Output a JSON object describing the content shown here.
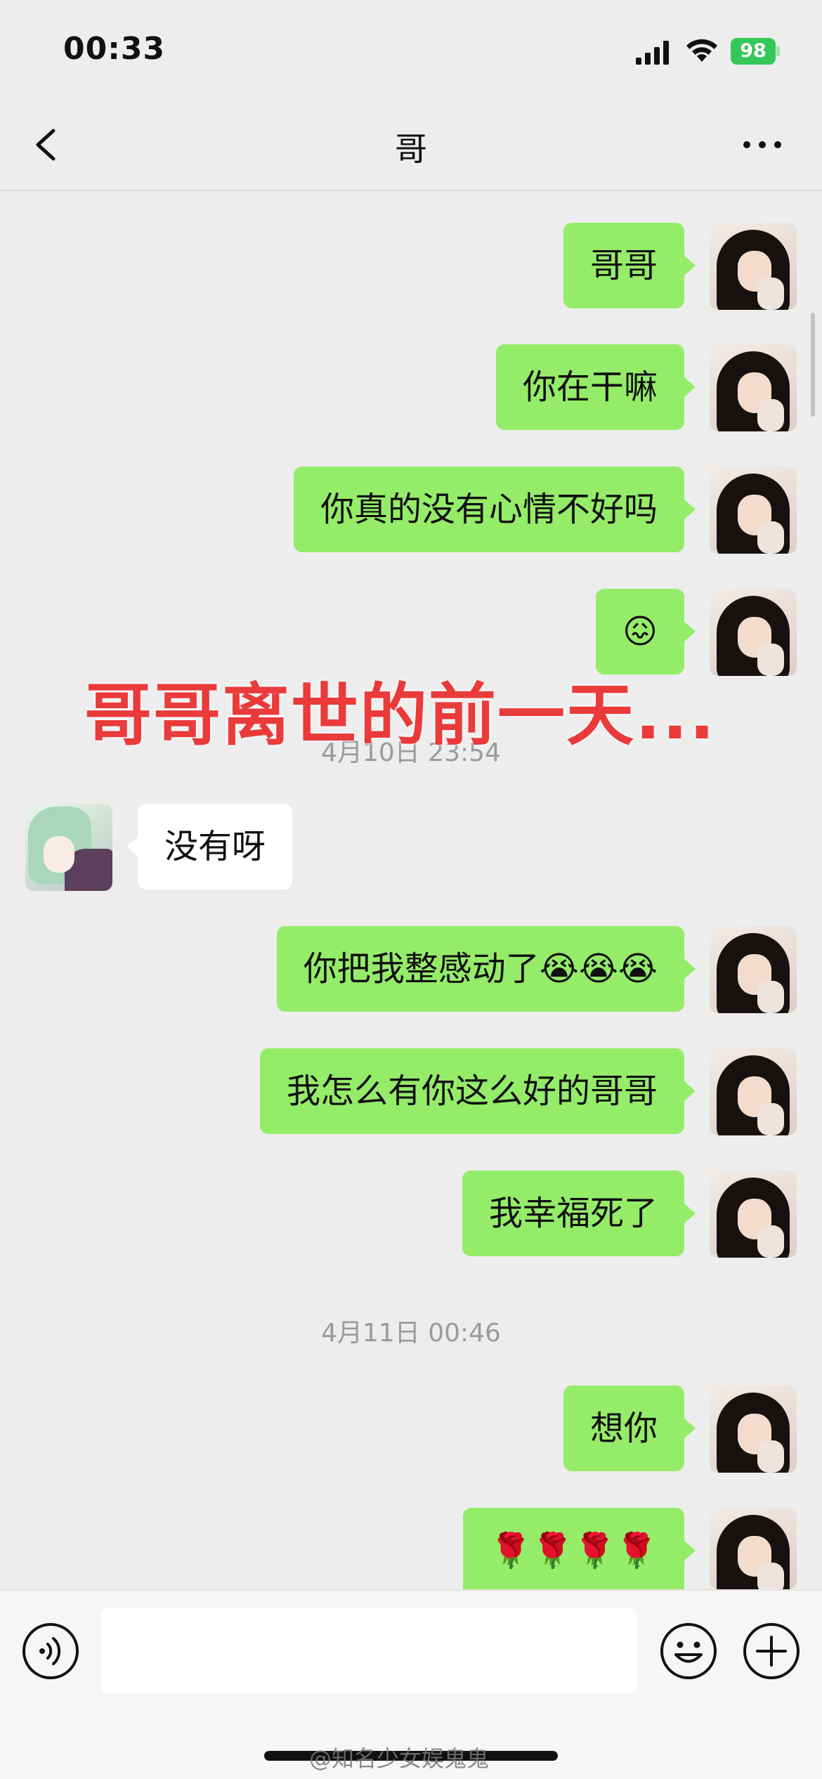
{
  "status_bar": {
    "time": "00:33",
    "battery": "98",
    "icons": [
      "signal-icon",
      "wifi-icon",
      "battery-charging-icon"
    ]
  },
  "header": {
    "title": "哥",
    "back_icon": "back-chevron-icon",
    "more_icon": "more-icon"
  },
  "messages": [
    {
      "type": "sent",
      "text": "哥哥"
    },
    {
      "type": "sent",
      "text": "你在干嘛"
    },
    {
      "type": "sent",
      "text": "你真的没有心情不好吗"
    },
    {
      "type": "sent",
      "text": "😖"
    },
    {
      "type": "time",
      "text": "4月10日 23:54"
    },
    {
      "type": "received",
      "text": "没有呀"
    },
    {
      "type": "sent",
      "text": "你把我整感动了😭😭😭"
    },
    {
      "type": "sent",
      "text": "我怎么有你这么好的哥哥"
    },
    {
      "type": "sent",
      "text": "我幸福死了"
    },
    {
      "type": "time",
      "text": "4月11日 00:46"
    },
    {
      "type": "sent",
      "text": "想你"
    },
    {
      "type": "sent",
      "text": "🌹🌹🌹🌹"
    }
  ],
  "overlay_caption": "哥哥离世的前一天...",
  "input_bar": {
    "value": "",
    "icons": [
      "voice-icon",
      "emoji-icon",
      "plus-icon"
    ]
  },
  "watermark": "@知名少女娱鬼鬼",
  "colors": {
    "sent_bubble": "#95ec69",
    "received_bubble": "#ffffff",
    "background": "#ededed",
    "caption": "#ea3a3a",
    "battery": "#34c759"
  }
}
